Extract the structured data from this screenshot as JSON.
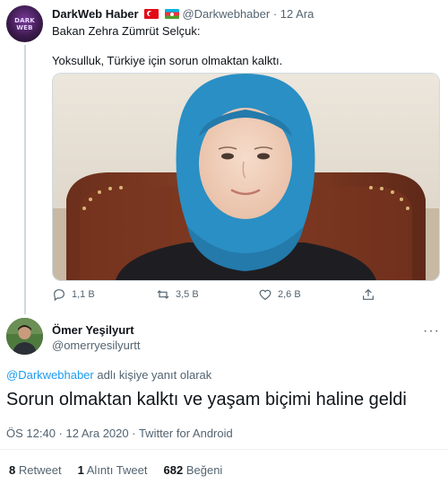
{
  "tweet": {
    "author_name": "DarkWeb Haber",
    "author_handle": "@Darkwebhaber",
    "separator": "·",
    "date": "12 Ara",
    "line1": "Bakan Zehra Zümrüt Selçuk:",
    "line2": "Yoksulluk, Türkiye için sorun olmaktan kalktı.",
    "avatar_text": "DARK WEB",
    "actions": {
      "reply_count": "1,1 B",
      "retweet_count": "3,5 B",
      "like_count": "2,6 B"
    },
    "flags": [
      "turkey-flag-icon",
      "azerbaijan-flag-icon"
    ]
  },
  "reply": {
    "author_name": "Ömer Yeşilyurt",
    "author_handle": "@omerryesilyurtt",
    "more_label": "···",
    "replying_to_handle": "@Darkwebhaber",
    "replying_to_suffix": " adlı kişiye yanıt olarak",
    "text": "Sorun olmaktan kalktı ve yaşam biçimi haline geldi",
    "time": "ÖS 12:40",
    "date": "12 Ara 2020",
    "source": "Twitter for Android",
    "meta_sep": " · ",
    "stats": {
      "retweets_count": "8",
      "retweets_label": "Retweet",
      "quotes_count": "1",
      "quotes_label": "Alıntı Tweet",
      "likes_count": "682",
      "likes_label": "Beğeni"
    }
  },
  "colors": {
    "accent": "#1d9bf0",
    "muted": "#536471",
    "text": "#0f1419",
    "hijab": "#2a8fc4"
  }
}
